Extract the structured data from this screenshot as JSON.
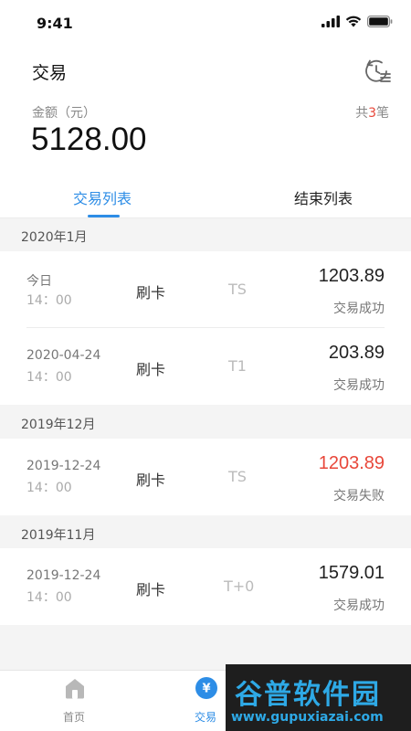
{
  "status_bar": {
    "time": "9:41",
    "icons": [
      "signal-icon",
      "wifi-icon",
      "battery-icon"
    ]
  },
  "header": {
    "title": "交易",
    "history_icon": "history-list-icon"
  },
  "summary": {
    "amount_label": "金额（元）",
    "amount_value": "5128.00",
    "count_prefix": "共",
    "count_number": "3",
    "count_suffix": "笔"
  },
  "tabs": {
    "active_label": "交易列表",
    "inactive_label": "结束列表"
  },
  "sections": [
    {
      "title": "2020年1月",
      "rows": [
        {
          "date": "今日",
          "time": "14：00",
          "type": "刷卡",
          "channel": "TS",
          "amount": "1203.89",
          "status": "交易成功",
          "failed": false
        },
        {
          "date": "2020-04-24",
          "time": "14：00",
          "type": "刷卡",
          "channel": "T1",
          "amount": "203.89",
          "status": "交易成功",
          "failed": false
        }
      ]
    },
    {
      "title": "2019年12月",
      "rows": [
        {
          "date": "2019-12-24",
          "time": "14：00",
          "type": "刷卡",
          "channel": "TS",
          "amount": "1203.89",
          "status": "交易失败",
          "failed": true
        }
      ]
    },
    {
      "title": "2019年11月",
      "rows": [
        {
          "date": "2019-12-24",
          "time": "14：00",
          "type": "刷卡",
          "channel": "T+0",
          "amount": "1579.01",
          "status": "交易成功",
          "failed": false
        }
      ]
    }
  ],
  "tabbar": {
    "home_label": "首页",
    "trade_label": "交易",
    "trade_icon_glyph": "¥"
  },
  "watermark": {
    "title": "谷普软件园",
    "url": "www.gupuxiazai.com"
  },
  "colors": {
    "accent": "#2d8de6",
    "fail": "#e8473a",
    "background_gray": "#f4f4f4"
  }
}
